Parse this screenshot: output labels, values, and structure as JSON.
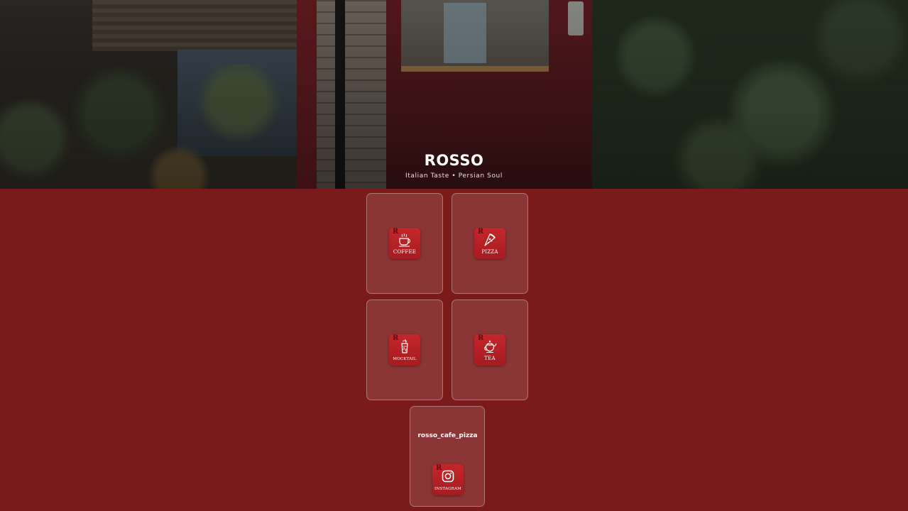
{
  "brand": {
    "title": "ROSSO",
    "tagline": "Italian Taste • Persian Soul"
  },
  "menu": {
    "items": [
      {
        "label": "COFFEE",
        "icon": "coffee-cup-icon"
      },
      {
        "label": "PIZZA",
        "icon": "pizza-slice-icon"
      },
      {
        "label": "MOCKTAIL",
        "icon": "mocktail-glass-icon"
      },
      {
        "label": "TEA",
        "icon": "teapot-icon"
      }
    ]
  },
  "social": {
    "handle": "rosso_cafe_pizza",
    "label": "INSTAGRAM",
    "icon": "instagram-icon"
  },
  "tile_monogram": "R",
  "colors": {
    "background": "#7a1a1b",
    "tile": "#b82226",
    "card": "rgba(255,255,255,0.12)",
    "text": "#ffffff"
  }
}
